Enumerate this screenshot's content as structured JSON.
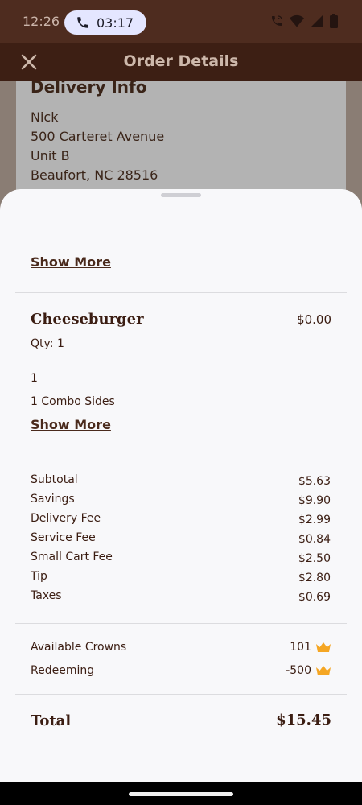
{
  "status_bar": {
    "time": "12:26",
    "call_duration": "03:17"
  },
  "header": {
    "title": "Order Details"
  },
  "delivery": {
    "heading": "Delivery Info",
    "name": "Nick",
    "address_line1": "500 Carteret Avenue",
    "address_line2": "Unit B",
    "city_state_zip": "Beaufort, NC 28516"
  },
  "sheet": {
    "show_more_top": "Show More",
    "item": {
      "name": "Cheeseburger",
      "price": "$0.00",
      "qty": "Qty: 1",
      "option1": "1",
      "option2": "1 Combo Sides",
      "show_more": "Show More"
    },
    "summary": [
      {
        "label": "Subtotal",
        "value": "$5.63"
      },
      {
        "label": "Savings",
        "value": "$9.90"
      },
      {
        "label": "Delivery Fee",
        "value": "$2.99"
      },
      {
        "label": "Service Fee",
        "value": "$0.84"
      },
      {
        "label": "Small Cart Fee",
        "value": "$2.50"
      },
      {
        "label": "Tip",
        "value": "$2.80"
      },
      {
        "label": "Taxes",
        "value": "$0.69"
      }
    ],
    "crowns": {
      "available_label": "Available Crowns",
      "available_value": "101",
      "redeeming_label": "Redeeming",
      "redeeming_value": "-500"
    },
    "total": {
      "label": "Total",
      "value": "$15.45"
    }
  },
  "colors": {
    "brand_brown": "#3d1f14",
    "crown_gold": "#f5a623",
    "sheet_bg": "#f8f8fa"
  }
}
